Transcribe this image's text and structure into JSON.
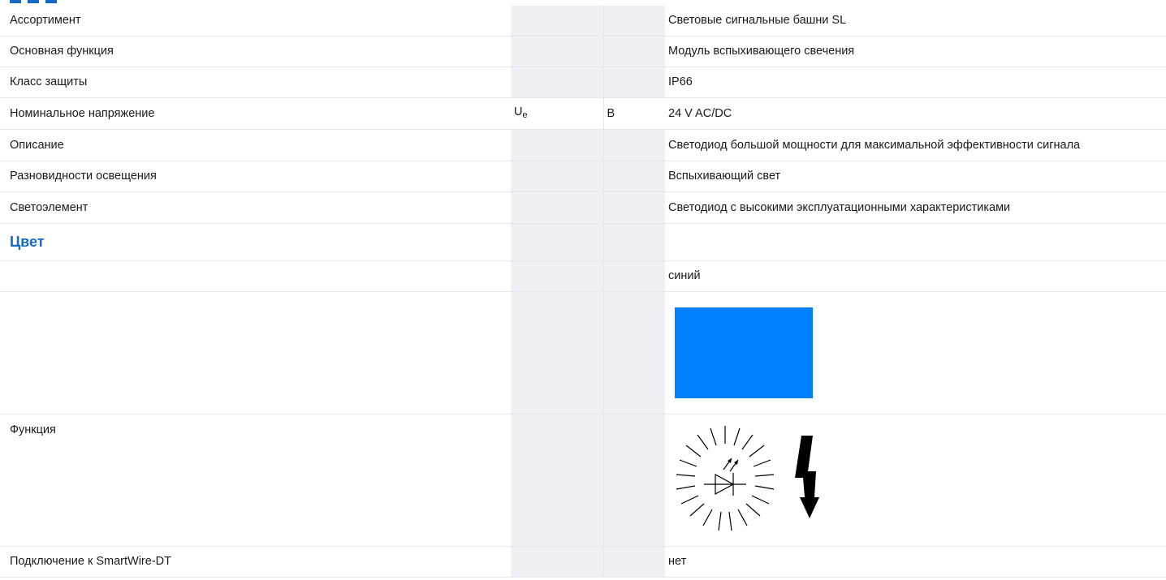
{
  "rows": [
    {
      "label": "Ассортимент",
      "value": "Световые сигнальные башни SL"
    },
    {
      "label": "Основная функция",
      "value": "Модуль вспыхивающего свечения"
    },
    {
      "label": "Класс защиты",
      "value": "IP66"
    },
    {
      "label": "Номинальное напряжение",
      "symbol": "U",
      "symbol_sub": "e",
      "unit": "В",
      "value": "24 V AC/DC"
    },
    {
      "label": "Описание",
      "value": "Светодиод большой мощности для максимальной эффективности сигнала"
    },
    {
      "label": "Разновидности освещения",
      "value": "Вспыхивающий свет"
    },
    {
      "label": "Светоэлемент",
      "value": "Светодиод с высокими эксплуатационными характеристиками"
    }
  ],
  "color_section": {
    "title": "Цвет",
    "value": "синий",
    "swatch_color": "#0080ff"
  },
  "function_row": {
    "label": "Функция",
    "icon": "flashing-led-icon"
  },
  "smartwire_row": {
    "label": "Подключение к SmartWire-DT",
    "value": "нет"
  }
}
